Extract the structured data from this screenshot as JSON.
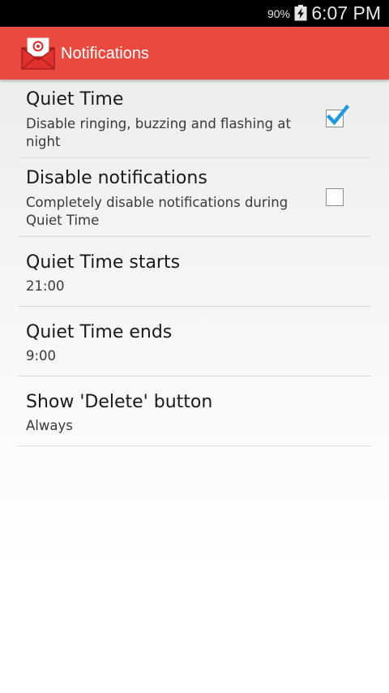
{
  "status_bar": {
    "battery_percent": "90%",
    "time": "6:07 PM",
    "battery_icon": "battery-charging-icon"
  },
  "action_bar": {
    "title": "Notifications",
    "app_icon": "mail-envelope-icon",
    "accent_color": "#e9493f"
  },
  "settings": {
    "quiet_time": {
      "title": "Quiet Time",
      "summary": "Disable ringing, buzzing and flashing at night",
      "checked": true
    },
    "disable_notifications": {
      "title": "Disable notifications",
      "summary": "Completely disable notifications during Quiet Time",
      "checked": false
    },
    "quiet_time_starts": {
      "title": "Quiet Time starts",
      "value": "21:00"
    },
    "quiet_time_ends": {
      "title": "Quiet Time ends",
      "value": "9:00"
    },
    "show_delete_button": {
      "title": "Show 'Delete' button",
      "value": "Always"
    }
  }
}
